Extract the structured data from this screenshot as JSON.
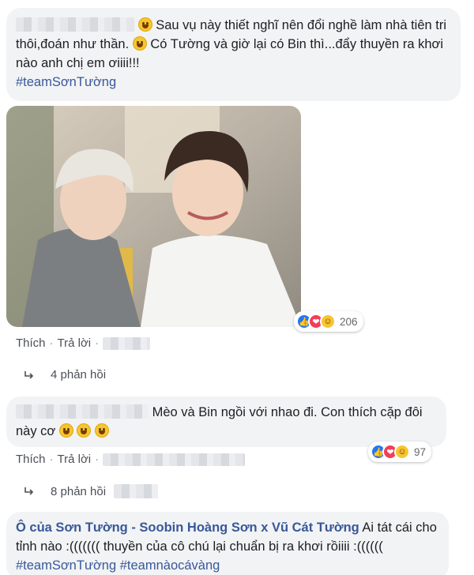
{
  "comments": [
    {
      "text": "Sau vụ này thiết nghĩ nên đổi nghề làm nhà tiên tri thôi,đoán như thần.",
      "text_after_emoji": "Có Tường và giờ lại có Bin thì...đẩy thuyền ra khơi nào anh chị em ơiiii!!!",
      "hashtag": "#teamSơnTường",
      "reaction_count": "206",
      "like_label": "Thích",
      "reply_label": "Trả lời",
      "replies_label": "4 phản hồi"
    },
    {
      "text": "Mèo và Bin ngồi với nhao đi. Con thích cặp đôi này cơ",
      "reaction_count": "97",
      "like_label": "Thích",
      "reply_label": "Trả lời",
      "replies_label": "8 phản hồi"
    },
    {
      "author": "Ô của Sơn Tường - Soobin Hoàng Sơn x Vũ Cát Tường",
      "text": "Ai tát cái cho tỉnh nào :((((((( thuyền của cô chú lại chuẩn bị ra khơi rồiiii :((((((",
      "hashtags": "#teamSơnTường #teamnàocávàng"
    }
  ],
  "icons": {
    "laugh": "rolling-on-floor-laughing-emoji",
    "smile": "smiling-emoji",
    "reactions": [
      "like-icon",
      "love-icon",
      "haha-icon"
    ]
  },
  "colors": {
    "bubble": "#f2f3f5",
    "link": "#385898",
    "like": "#2078f4",
    "love": "#f33e58",
    "haha": "#f7c531"
  }
}
